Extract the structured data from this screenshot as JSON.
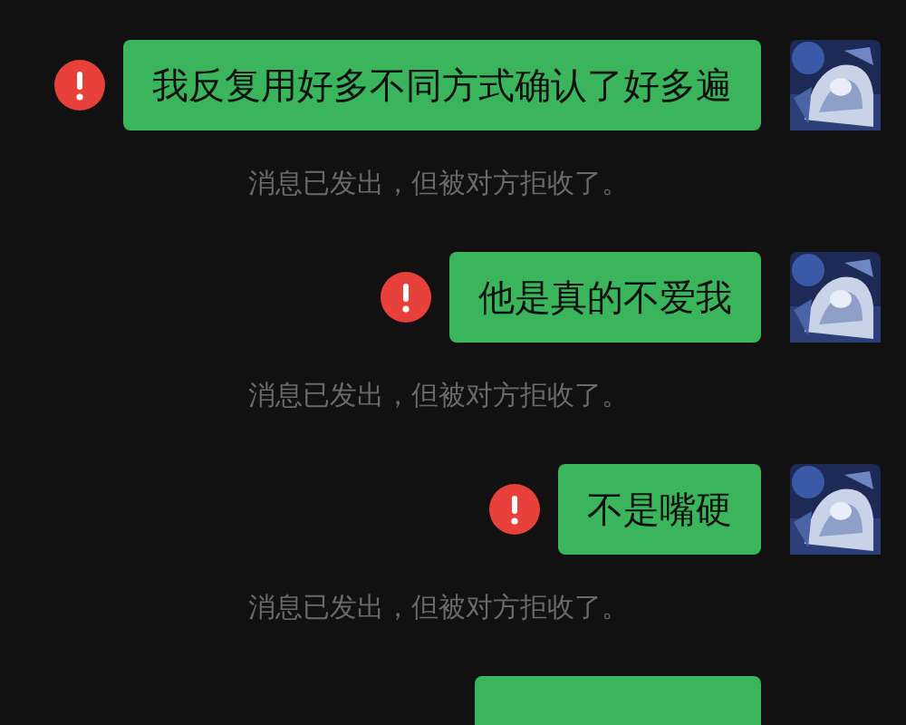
{
  "messages": [
    {
      "kind": "text",
      "text": "我反复用好多不同方式确认了好多遍",
      "failed": true,
      "notice": "消息已发出，但被对方拒收了。"
    },
    {
      "kind": "text",
      "text": "他是真的不爱我",
      "failed": true,
      "notice": "消息已发出，但被对方拒收了。"
    },
    {
      "kind": "text",
      "text": "不是嘴硬",
      "failed": true,
      "notice": "消息已发出，但被对方拒收了。"
    },
    {
      "kind": "cut"
    }
  ]
}
